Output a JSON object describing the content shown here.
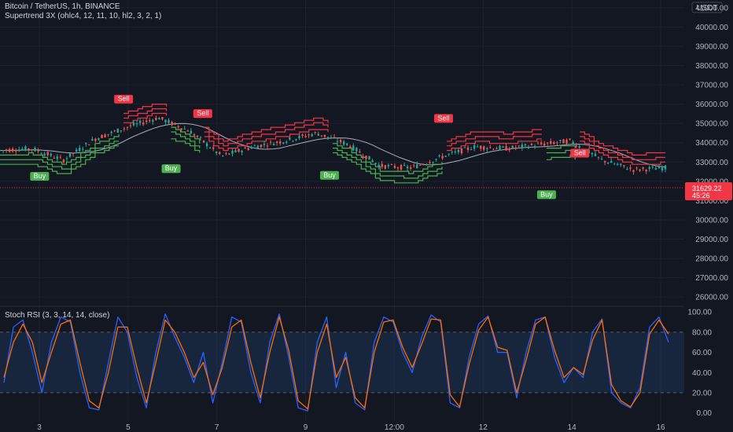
{
  "header": {
    "symbol_line": "Bitcoin / TetherUS, 1h, BINANCE",
    "indicator_line": "Supertrend 3X (ohlc4, 12, 11, 10, hl2, 3, 2, 1)",
    "currency": "USDT"
  },
  "price_badge": {
    "price": "31629.22",
    "countdown": "45:26",
    "color": "#f23645"
  },
  "oscillator": {
    "title": "Stoch RSI (3, 3, 14, 14, close)"
  },
  "colors": {
    "background": "#131722",
    "grid": "#1e222d",
    "up": "#26a69a",
    "down": "#ef5350",
    "supertrend_up": "#4caf50",
    "supertrend_down": "#f23645",
    "ma": "#d1d4dc",
    "k_line": "#2962ff",
    "d_line": "#ff6d00",
    "osc_band": "#1e3a5f"
  },
  "chart_data": [
    {
      "type": "line",
      "role": "price-panel",
      "series": [
        {
          "x": [
            0,
            2,
            4,
            6,
            8,
            10,
            12,
            14,
            16,
            18,
            20,
            22,
            24,
            26,
            28,
            30,
            32,
            34,
            36,
            38,
            40,
            42
          ],
          "values": [
            33600,
            33700,
            33100,
            34200,
            34800,
            35300,
            34600,
            33300,
            33800,
            34100,
            34500,
            33900,
            32800,
            32700,
            33300,
            33800,
            33700,
            33900,
            34100,
            33100,
            32600,
            32700
          ]
        }
      ],
      "x_ticks": [
        "3",
        "5",
        "7",
        "9",
        "12:00",
        "12",
        "14",
        "16"
      ],
      "y_ticks": [
        "41000.00",
        "40000.00",
        "39000.00",
        "38000.00",
        "37000.00",
        "36000.00",
        "35000.00",
        "34000.00",
        "33000.00",
        "32000.00",
        "31000.00",
        "30000.00",
        "29000.00",
        "28000.00",
        "27000.00",
        "26000.00"
      ],
      "ylim": [
        25600,
        41400
      ],
      "signals": [
        {
          "label": "Sell",
          "x": 7.8,
          "price": 35750
        },
        {
          "label": "Buy",
          "x": 2.5,
          "price": 32400
        },
        {
          "label": "Buy",
          "x": 10.8,
          "price": 32800
        },
        {
          "label": "Sell",
          "x": 12.8,
          "price": 35000
        },
        {
          "label": "Buy",
          "x": 20.8,
          "price": 32450
        },
        {
          "label": "Sell",
          "x": 28.0,
          "price": 34750
        },
        {
          "label": "Buy",
          "x": 34.5,
          "price": 31450
        },
        {
          "label": "Sell",
          "x": 36.6,
          "price": 32950
        }
      ]
    },
    {
      "type": "line",
      "role": "oscillator-panel",
      "title": "Stoch RSI (3, 3, 14, 14, close)",
      "series": [
        {
          "name": "K",
          "values": [
            30,
            85,
            92,
            60,
            20,
            70,
            95,
            90,
            40,
            5,
            3,
            50,
            95,
            80,
            35,
            5,
            60,
            98,
            75,
            55,
            30,
            60,
            10,
            50,
            95,
            90,
            40,
            10,
            70,
            98,
            55,
            5,
            2,
            70,
            95,
            25,
            60,
            10,
            3,
            70,
            95,
            90,
            60,
            40,
            75,
            97,
            90,
            10,
            5,
            55,
            88,
            96,
            60,
            60,
            15,
            60,
            92,
            95,
            55,
            30,
            45,
            35,
            80,
            93,
            20,
            10,
            5,
            25,
            85,
            95,
            70
          ]
        },
        {
          "name": "D",
          "values": [
            35,
            70,
            88,
            70,
            30,
            60,
            88,
            92,
            50,
            12,
            5,
            40,
            85,
            85,
            45,
            10,
            50,
            92,
            80,
            60,
            35,
            50,
            18,
            45,
            85,
            92,
            50,
            15,
            60,
            95,
            62,
            12,
            4,
            60,
            88,
            35,
            55,
            15,
            5,
            60,
            90,
            92,
            65,
            45,
            68,
            93,
            92,
            18,
            6,
            48,
            82,
            95,
            65,
            62,
            20,
            52,
            88,
            95,
            62,
            35,
            45,
            38,
            72,
            92,
            28,
            12,
            6,
            20,
            78,
            92,
            78
          ]
        }
      ],
      "y_ticks": [
        "100.00",
        "80.00",
        "60.00",
        "40.00",
        "20.00",
        "0.00"
      ],
      "bands": [
        20,
        80
      ],
      "ylim": [
        -8,
        104
      ]
    }
  ]
}
